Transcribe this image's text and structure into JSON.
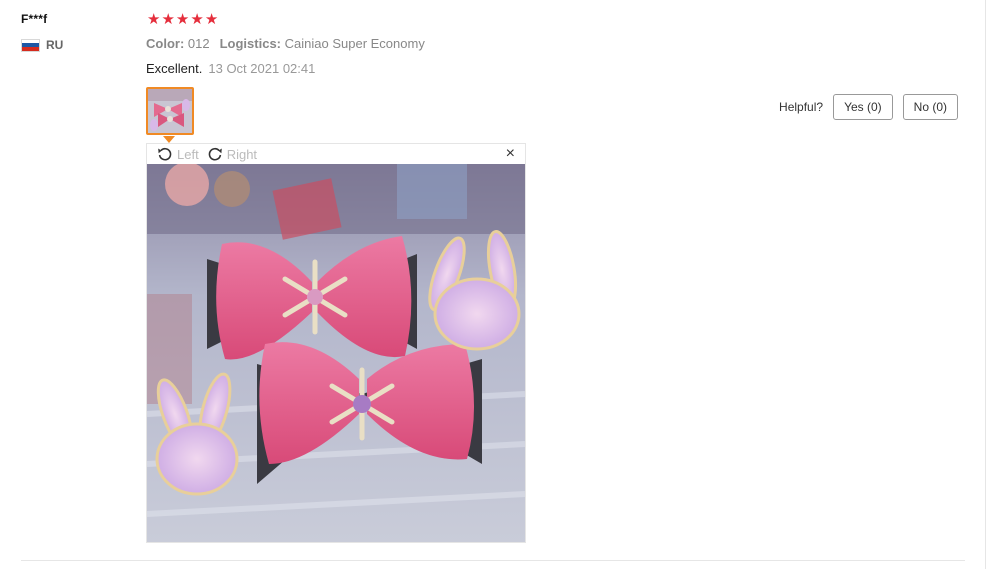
{
  "reviewer": {
    "name": "F***f",
    "country_code": "RU",
    "flag_colors": [
      "#ffffff",
      "#1c57a5",
      "#d52b1e"
    ]
  },
  "rating": {
    "stars": 5,
    "max": 5,
    "star_glyph": "★",
    "color": "#e52e3c"
  },
  "attributes": [
    {
      "label": "Color:",
      "value": "012"
    },
    {
      "label": "Logistics:",
      "value": "Cainiao Super Economy"
    }
  ],
  "review": {
    "text": "Excellent.",
    "date": "13 Oct 2021 02:41"
  },
  "helpful": {
    "label": "Helpful?",
    "yes": "Yes (0)",
    "no": "No (0)"
  },
  "viewer": {
    "rotate_left": "Left",
    "rotate_right": "Right",
    "close": "×"
  },
  "image": {
    "subject": "pink tulle hair bows with snowflake centers and glitter bunny patches",
    "accent_color": "#f08a24"
  }
}
